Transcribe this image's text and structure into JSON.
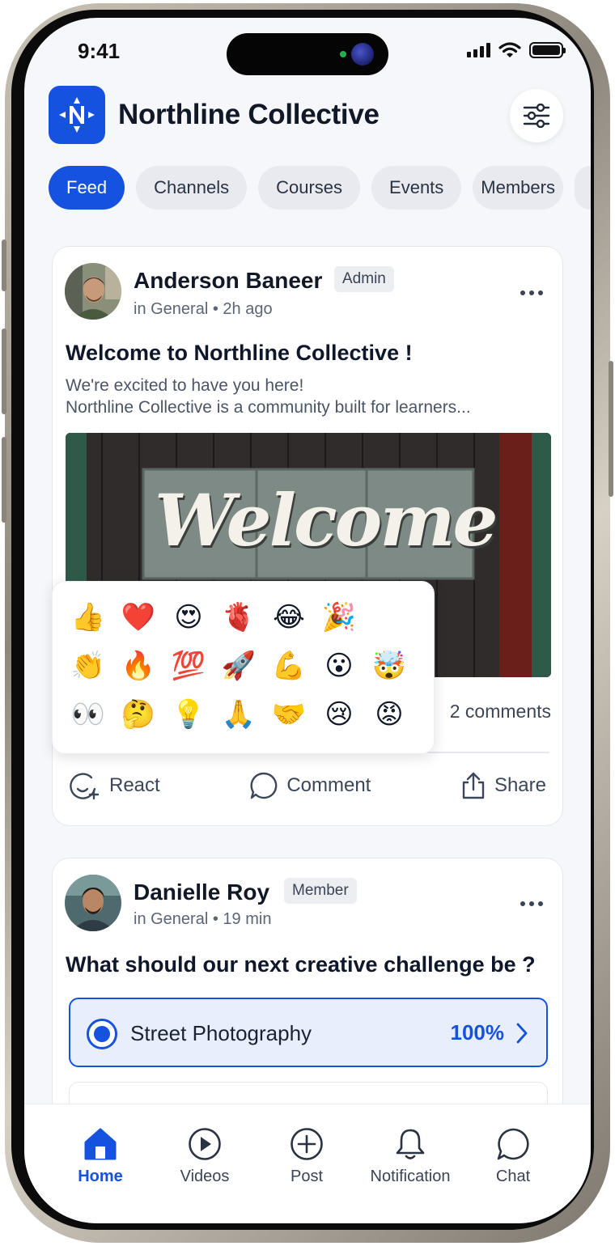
{
  "status_bar": {
    "time": "9:41"
  },
  "app": {
    "title": "Northline Collective"
  },
  "tabs": [
    "Feed",
    "Channels",
    "Courses",
    "Events",
    "Members"
  ],
  "posts": [
    {
      "author": "Anderson Baneer",
      "role": "Admin",
      "channel": "in General",
      "time": "2h ago",
      "title": "Welcome to Northline Collective !",
      "body_line1": "We're excited to have you here!",
      "body_line2": "Northline Collective is a community built for learners...",
      "image_text": "Welcome",
      "comments": "2 comments"
    },
    {
      "author": "Danielle Roy",
      "role": "Member",
      "channel": "in General",
      "time": "19 min",
      "title": "What should our next creative challenge be ?",
      "poll_option": "Street Photography",
      "poll_percent": "100%"
    }
  ],
  "post_actions": {
    "react": "React",
    "comment": "Comment",
    "share": "Share"
  },
  "emoji_picker": [
    "👍",
    "❤️",
    "😍",
    "🫀",
    "😂",
    "🎉",
    "👏",
    "🔥",
    "💯",
    "🚀",
    "💪",
    "😮",
    "🤯",
    "👀",
    "🤔",
    "💡",
    "🙏",
    "🤝",
    "😢",
    "😡"
  ],
  "bottom_nav": [
    "Home",
    "Videos",
    "Post",
    "Notification",
    "Chat"
  ],
  "colors": {
    "accent": "#1552e0",
    "background": "#f6f7fa"
  }
}
